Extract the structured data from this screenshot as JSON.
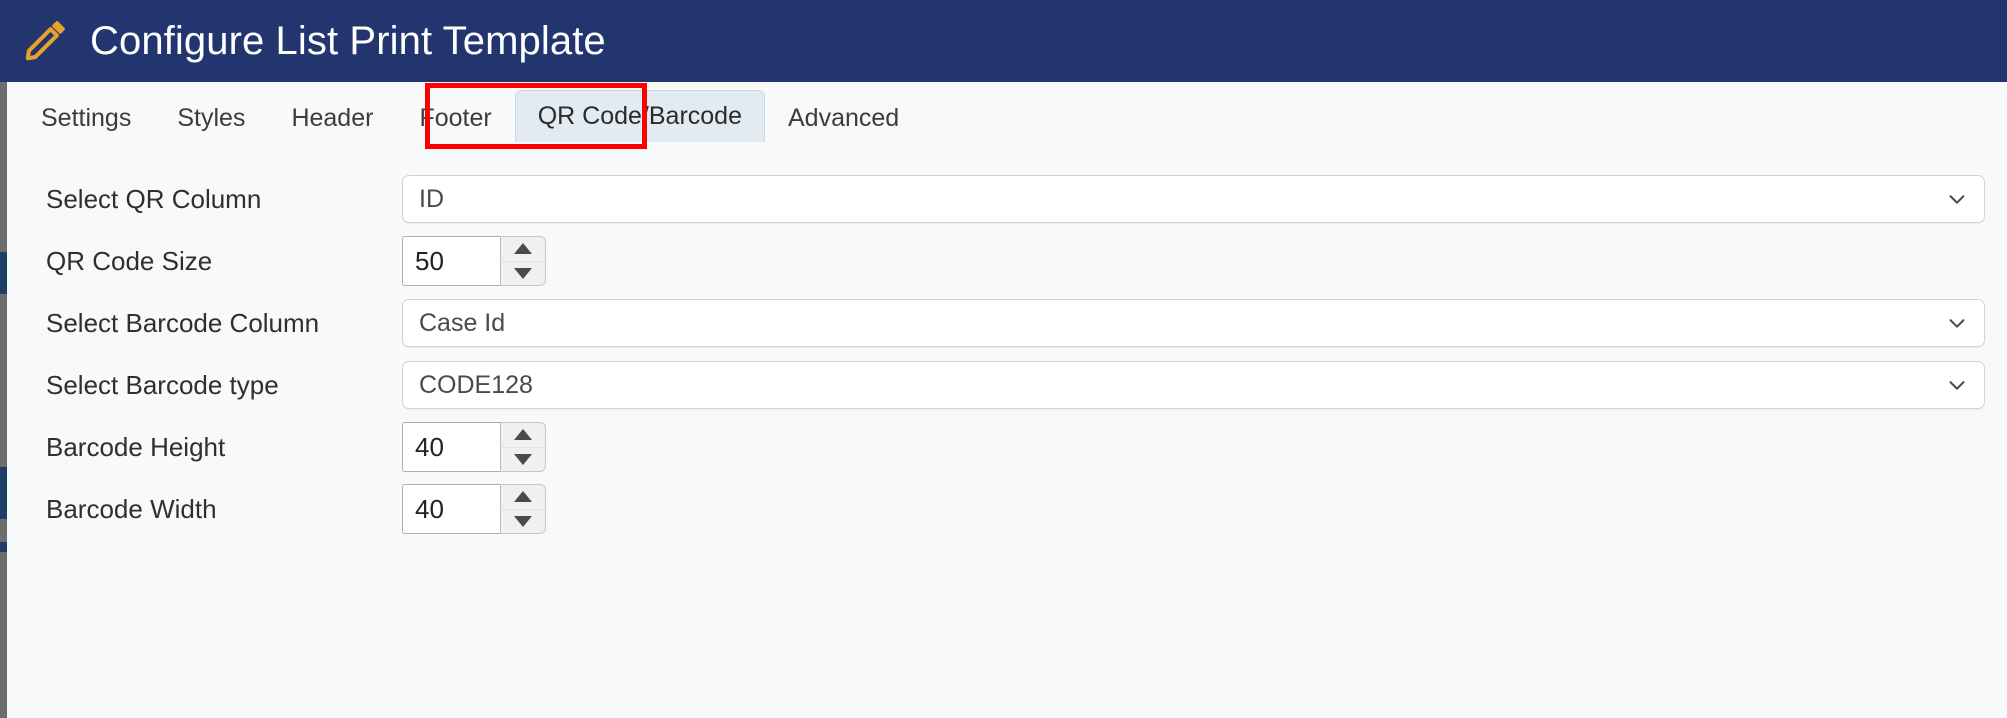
{
  "header": {
    "title": "Configure List Print Template",
    "icon": "pencil-icon",
    "bg_color": "#23356e",
    "icon_color": "#e8a42a"
  },
  "tabs": {
    "items": [
      {
        "label": "Settings",
        "active": false
      },
      {
        "label": "Styles",
        "active": false
      },
      {
        "label": "Header",
        "active": false
      },
      {
        "label": "Footer",
        "active": false
      },
      {
        "label": "QR Code/Barcode",
        "active": true
      },
      {
        "label": "Advanced",
        "active": false
      }
    ],
    "active_tab": "QR Code/Barcode",
    "highlight_color": "#ff0000",
    "active_underline_color": "#23356e"
  },
  "form": {
    "rows": [
      {
        "label": "Select QR Column",
        "control": "select",
        "value": "ID",
        "name": "select-qr-column"
      },
      {
        "label": "QR Code Size",
        "control": "spinner",
        "value": "50",
        "name": "qr-code-size"
      },
      {
        "label": "Select Barcode Column",
        "control": "select",
        "value": "Case Id",
        "name": "select-barcode-column"
      },
      {
        "label": "Select Barcode type",
        "control": "select",
        "value": "CODE128",
        "name": "select-barcode-type"
      },
      {
        "label": "Barcode Height",
        "control": "spinner",
        "value": "40",
        "name": "barcode-height"
      },
      {
        "label": "Barcode Width",
        "control": "spinner",
        "value": "40",
        "name": "barcode-width"
      }
    ]
  }
}
